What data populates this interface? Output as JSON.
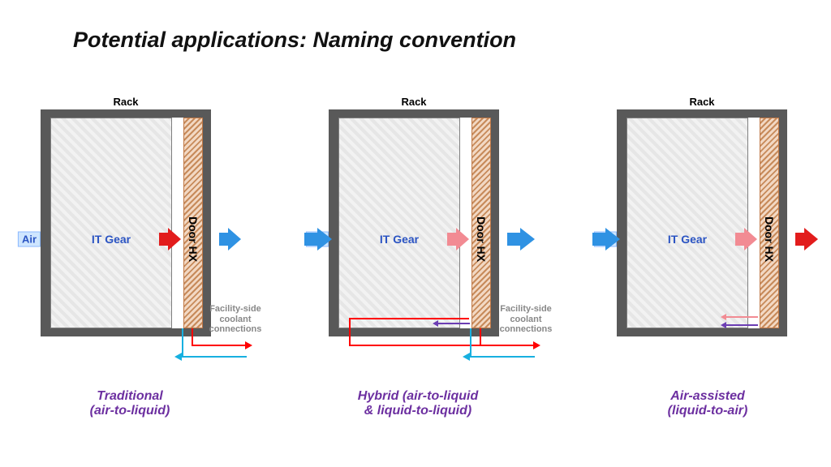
{
  "slide_title": "Potential applications: Naming convention",
  "common": {
    "rack_label": "Rack",
    "it_gear_label": "IT Gear",
    "door_label": "Door HX",
    "air_label": "Air",
    "coolant_label_line1": "Facility-side",
    "coolant_label_line2": "coolant",
    "coolant_label_line3": "connections"
  },
  "panels": [
    {
      "id": "traditional",
      "caption_line1": "Traditional",
      "caption_line2": "(air-to-liquid)",
      "inlet_arrow_color": "blue",
      "mid_arrow_color": "red",
      "outlet_arrow_color": "blue",
      "has_facility_coolant_label": true,
      "has_internal_liquid_loop": false
    },
    {
      "id": "hybrid",
      "caption_line1": "Hybrid (air-to-liquid",
      "caption_line2": "& liquid-to-liquid)",
      "inlet_arrow_color": "blue",
      "mid_arrow_color": "pink",
      "outlet_arrow_color": "blue",
      "has_facility_coolant_label": true,
      "has_internal_liquid_loop": true
    },
    {
      "id": "air_assisted",
      "caption_line1": "Air-assisted",
      "caption_line2": "(liquid-to-air)",
      "inlet_arrow_color": "blue",
      "mid_arrow_color": "pink",
      "outlet_arrow_color": "red",
      "has_facility_coolant_label": false,
      "has_internal_liquid_loop": true
    }
  ],
  "colors": {
    "arrow_blue": "#2f92e3",
    "arrow_red": "#e21c1c",
    "arrow_pink": "#f28b93",
    "pipe_hot": "#ff0000",
    "pipe_cold": "#17b0e0",
    "pipe_internal": "#6b3db3",
    "pipe_internal2": "#f28b93",
    "caption": "#6c2fa0",
    "it_gear_text": "#2b54c3"
  }
}
